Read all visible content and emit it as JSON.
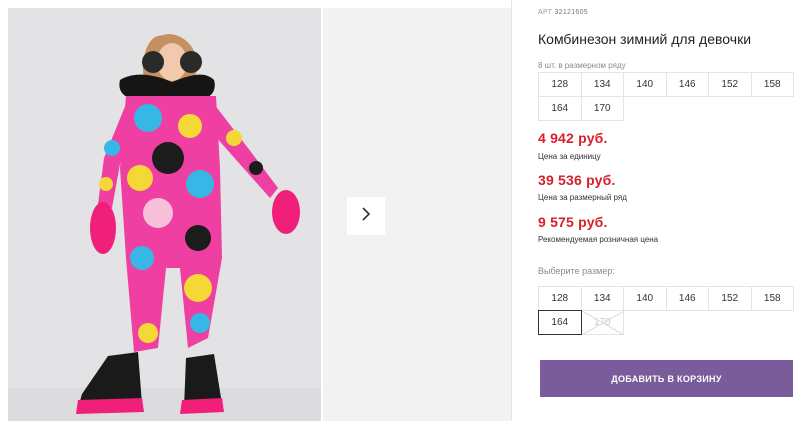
{
  "gallery": {
    "next_icon": "chevron-right-icon",
    "photo_description": "child-in-snowsuit-photo"
  },
  "product": {
    "art_prefix": "АРТ",
    "art_number": "32121605",
    "title": "Комбинезон зимний для девочки",
    "row_note": "8 шт. в размерном ряду",
    "row_sizes": [
      "128",
      "134",
      "140",
      "146",
      "152",
      "158",
      "164",
      "170"
    ],
    "price_unit": "4 942 руб.",
    "price_unit_label": "Цена за единицу",
    "price_row": "39 536 руб.",
    "price_row_label": "Цена за размерный ряд",
    "price_retail": "9 575 руб.",
    "price_retail_label": "Рекомендуемая розничная цена",
    "price_color": "#d81f2a"
  },
  "size_picker": {
    "label": "Выберите размер:",
    "sizes": [
      "128",
      "134",
      "140",
      "146",
      "152",
      "158",
      "164",
      "170"
    ],
    "selected": "164",
    "unavailable": [
      "170"
    ]
  },
  "cart": {
    "button_label": "ДОБАВИТЬ В КОРЗИНУ",
    "button_color": "#7a5c9a"
  }
}
